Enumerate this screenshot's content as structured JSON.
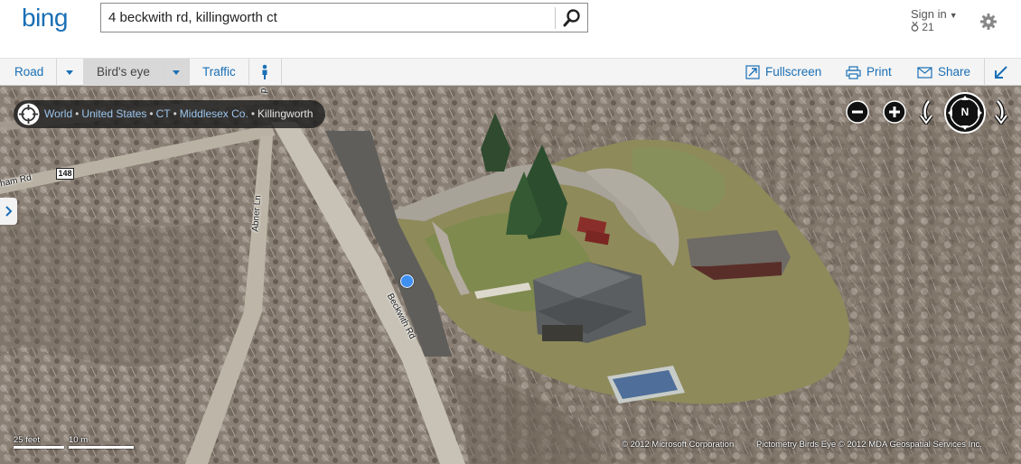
{
  "header": {
    "logo": "bing",
    "search_value": "4 beckwith rd, killingworth ct",
    "signin_label": "Sign in",
    "rewards_count": "21",
    "icons": {
      "search": "search-icon",
      "settings": "gear-icon",
      "rewards": "medal-icon"
    }
  },
  "toolbar": {
    "road_label": "Road",
    "birdseye_label": "Bird's eye",
    "traffic_label": "Traffic",
    "fullscreen_label": "Fullscreen",
    "print_label": "Print",
    "share_label": "Share",
    "icons": {
      "streetside": "person-icon",
      "fullscreen": "fullscreen-icon",
      "print": "printer-icon",
      "share": "envelope-icon",
      "collapse": "collapse-arrow-icon"
    }
  },
  "map": {
    "breadcrumb": [
      "World",
      "United States",
      "CT",
      "Middlesex Co.",
      "Killingworth"
    ],
    "road_labels": {
      "route": "148",
      "ham_rd": "ham Rd",
      "abner": "Abner Ln",
      "beckwith": "Beckwith Rd"
    },
    "controls": {
      "zoom_out": "zoom-out-icon",
      "zoom_in": "zoom-in-icon",
      "rotate_left": "rotate-left-icon",
      "compass": "N",
      "rotate_right": "rotate-right-icon"
    },
    "scale": {
      "feet": "25 feet",
      "meters": "10 m"
    },
    "copyright_ms": "© 2012 Microsoft Corporation",
    "copyright_pictometry": "Pictometry Birds Eye © 2012 MDA Geospatial Services Inc.",
    "colors": {
      "pin": "#3e8ff2",
      "breadcrumb_link": "#9cc6ef",
      "brand": "#1a6fb5"
    }
  }
}
